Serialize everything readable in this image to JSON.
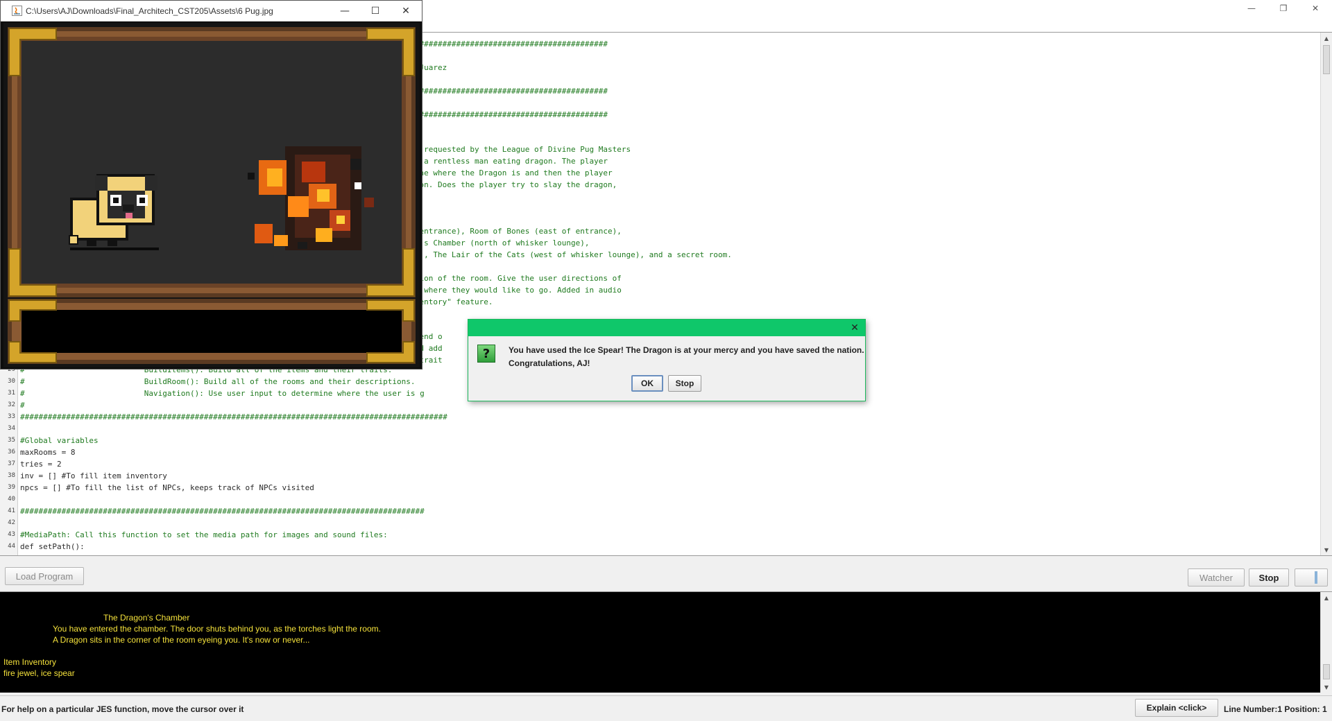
{
  "editor": {
    "code_lines": [
      {
        "n": "",
        "text": "#############################################"
      },
      {
        "n": "",
        "text": "uan Juarez"
      },
      {
        "n": "",
        "text": "#############################################"
      },
      {
        "n": "",
        "text": "#############################################"
      },
      {
        "n": "",
        "text": "been requested by the League of Divine Pug Masters"
      },
      {
        "n": "",
        "text": "d by a rentless man eating dragon. The player"
      },
      {
        "n": "",
        "text": "ermine where the Dragon is and then the player"
      },
      {
        "n": "",
        "text": "dragon. Does the player try to slay the dragon,"
      },
      {
        "n": "",
        "text": " of entrance), Room of Bones (east of entrance),"
      },
      {
        "n": "",
        "text": "agon's Chamber (north of whisker lounge),"
      },
      {
        "n": "",
        "text": "unge), The Lair of the Cats (west of whisker lounge), and a secret room."
      },
      {
        "n": "",
        "text": "ription of the room. Give the user directions of"
      },
      {
        "n": "",
        "text": "user where they would like to go. Added in audio"
      },
      {
        "n": "",
        "text": " inventory\" feature."
      },
      {
        "n": "",
        "text": "the end o"
      },
      {
        "n": "",
        "text": ", and add"
      },
      {
        "n": "",
        "text": "eir trait"
      }
    ],
    "lower_lines": [
      {
        "n": "29",
        "text": "#                          BuildItems(): Build all of the items and their traits.",
        "plain": false
      },
      {
        "n": "30",
        "text": "#                          BuildRoom(): Build all of the rooms and their descriptions.",
        "plain": false
      },
      {
        "n": "31",
        "text": "#                          Navigation(): Use user input to determine where the user is g",
        "plain": false
      },
      {
        "n": "32",
        "text": "#",
        "plain": false
      },
      {
        "n": "33",
        "text": "#############################################################################################",
        "plain": false
      },
      {
        "n": "34",
        "text": "",
        "plain": false
      },
      {
        "n": "35",
        "text": "#Global variables",
        "plain": false
      },
      {
        "n": "36",
        "text": "maxRooms = 8",
        "plain": true
      },
      {
        "n": "37",
        "text": "tries = 2",
        "plain": true
      },
      {
        "n": "38",
        "text": "inv = [] #To fill item inventory",
        "plain": true
      },
      {
        "n": "39",
        "text": "npcs = [] #To fill the list of NPCs, keeps track of NPCs visited",
        "plain": true
      },
      {
        "n": "40",
        "text": "",
        "plain": false
      },
      {
        "n": "41",
        "text": "########################################################################################",
        "plain": false
      },
      {
        "n": "42",
        "text": "",
        "plain": false
      },
      {
        "n": "43",
        "text": "#MediaPath: Call this function to set the media path for images and sound files:",
        "plain": false
      },
      {
        "n": "44",
        "text": "def setPath():",
        "plain": true
      }
    ]
  },
  "toolbar": {
    "load_program": "Load Program",
    "watcher": "Watcher",
    "stop": "Stop"
  },
  "console": {
    "room_title": "The Dragon's Chamber",
    "line1": "You have entered the chamber. The door shuts behind you, as the torches light the room.",
    "line2": "A Dragon sits in the corner of the room eyeing you. It's now or never...",
    "inventory_label": "Item Inventory",
    "inventory_items": "fire jewel, ice spear"
  },
  "statusbar": {
    "help": "For help on a particular JES function, move the cursor over it",
    "explain": "Explain <click>",
    "position": "Line Number:1 Position: 1"
  },
  "picture_window": {
    "title": "C:\\Users\\AJ\\Downloads\\Final_Architech_CST205\\Assets\\6 Pug.jpg"
  },
  "dialog": {
    "message_line1": "You have used the Ice Spear! The Dragon is at your mercy and you have saved the nation.",
    "message_line2": "Congratulations, AJ!",
    "ok": "OK",
    "stop": "Stop"
  },
  "icons": {
    "minimize": "minimize-icon",
    "maximize": "maximize-icon",
    "close": "close-icon",
    "question": "question-icon"
  },
  "colors": {
    "dialog_title": "#0fc76a",
    "console_text": "#f5e23b",
    "code_comment": "#1f7a1f"
  }
}
